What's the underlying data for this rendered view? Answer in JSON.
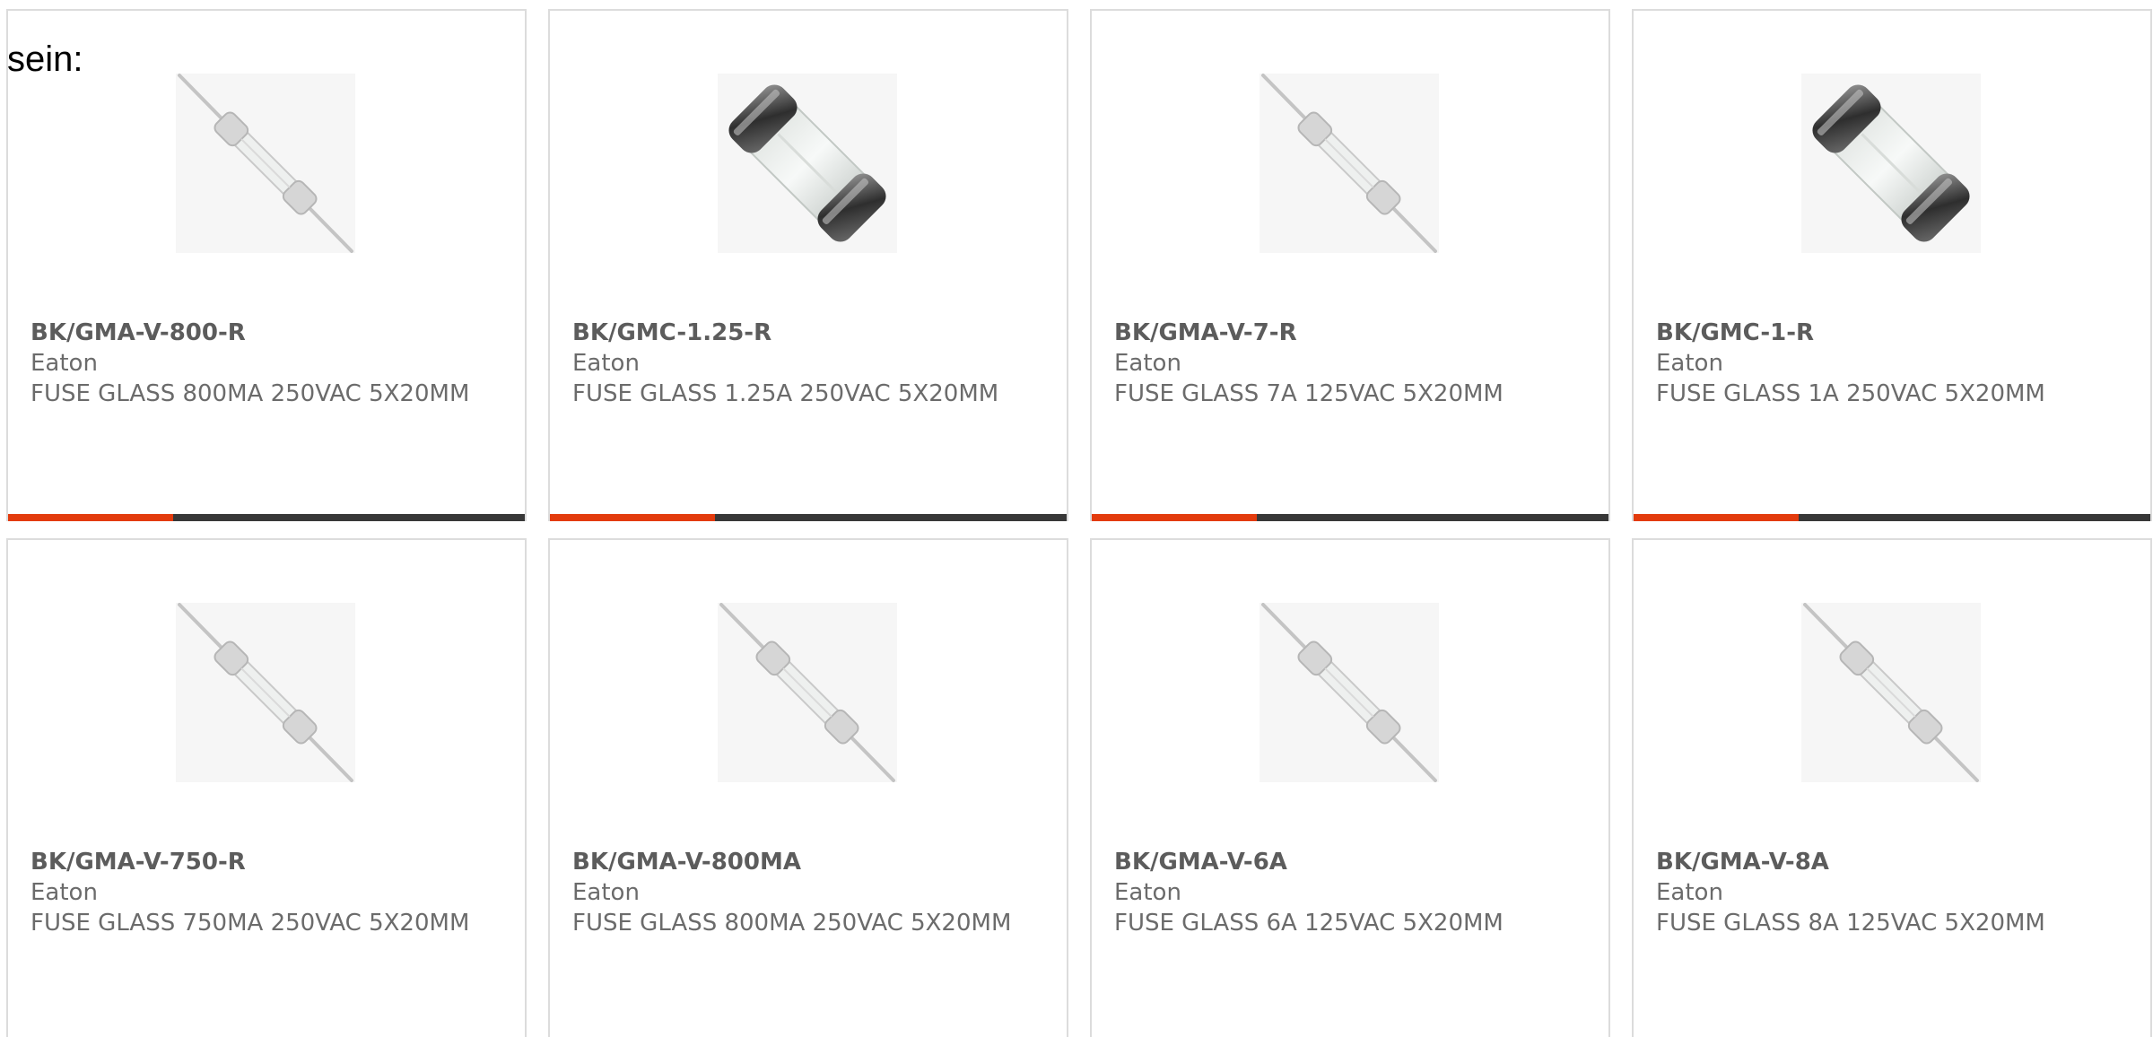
{
  "intro_text": "sein:",
  "colors": {
    "accent": "#e33b0d",
    "bar": "#383838",
    "card_border": "#dcdcdc",
    "part_text": "#5c5c5c",
    "body_text": "#6b6b6b"
  },
  "products": [
    {
      "part": "BK/GMA-V-800-R",
      "maker": "Eaton",
      "description": "FUSE GLASS 800MA 250VAC 5X20MM",
      "image": "axial-lead-glass-fuse",
      "progress_highlight": 0.32
    },
    {
      "part": "BK/GMC-1.25-R",
      "maker": "Eaton",
      "description": "FUSE GLASS 1.25A 250VAC 5X20MM",
      "image": "cartridge-glass-fuse",
      "progress_highlight": 0.32
    },
    {
      "part": "BK/GMA-V-7-R",
      "maker": "Eaton",
      "description": "FUSE GLASS 7A 125VAC 5X20MM",
      "image": "axial-lead-glass-fuse",
      "progress_highlight": 0.32
    },
    {
      "part": "BK/GMC-1-R",
      "maker": "Eaton",
      "description": "FUSE GLASS 1A 250VAC 5X20MM",
      "image": "cartridge-glass-fuse",
      "progress_highlight": 0.32
    },
    {
      "part": "BK/GMA-V-750-R",
      "maker": "Eaton",
      "description": "FUSE GLASS 750MA 250VAC 5X20MM",
      "image": "axial-lead-glass-fuse"
    },
    {
      "part": "BK/GMA-V-800MA",
      "maker": "Eaton",
      "description": "FUSE GLASS 800MA 250VAC 5X20MM",
      "image": "axial-lead-glass-fuse"
    },
    {
      "part": "BK/GMA-V-6A",
      "maker": "Eaton",
      "description": "FUSE GLASS 6A 125VAC 5X20MM",
      "image": "axial-lead-glass-fuse"
    },
    {
      "part": "BK/GMA-V-8A",
      "maker": "Eaton",
      "description": "FUSE GLASS 8A 125VAC 5X20MM",
      "image": "axial-lead-glass-fuse"
    }
  ]
}
